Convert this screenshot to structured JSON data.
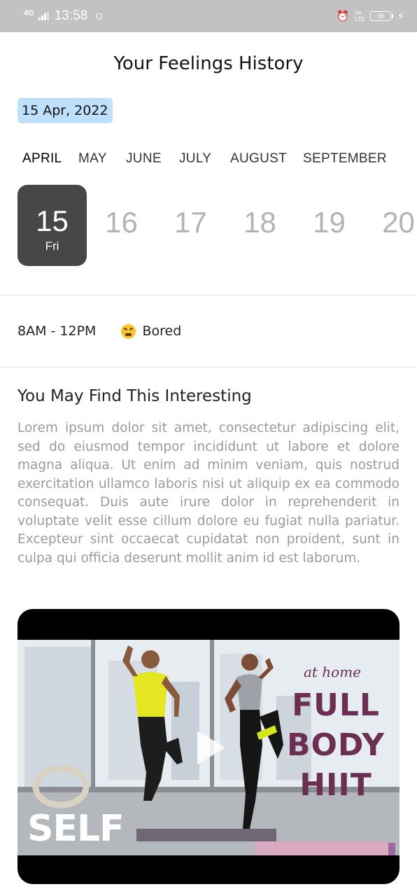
{
  "status_bar": {
    "network": "4G",
    "time": "13:58",
    "lte_label": "LTE",
    "volte_label": "Vo",
    "battery": "96",
    "icons": [
      "signal-icon",
      "usb-icon",
      "alarm-icon",
      "volte-icon",
      "battery-icon",
      "charging-icon"
    ]
  },
  "header": {
    "title": "Your Feelings History"
  },
  "selected_date": "15 Apr, 2022",
  "months": [
    {
      "label": "APRIL",
      "active": true
    },
    {
      "label": "MAY",
      "active": false
    },
    {
      "label": "JUNE",
      "active": false
    },
    {
      "label": "JULY",
      "active": false
    },
    {
      "label": "AUGUST",
      "active": false
    },
    {
      "label": "SEPTEMBER",
      "active": false
    }
  ],
  "days": [
    {
      "num": "15",
      "name": "Fri",
      "active": true
    },
    {
      "num": "16",
      "name": "",
      "active": false
    },
    {
      "num": "17",
      "name": "",
      "active": false
    },
    {
      "num": "18",
      "name": "",
      "active": false
    },
    {
      "num": "19",
      "name": "",
      "active": false
    },
    {
      "num": "20",
      "name": "",
      "active": false
    }
  ],
  "feeling": {
    "time_range": "8AM - 12PM",
    "emoji_icon": "tired-face-emoji-icon",
    "label": "Bored"
  },
  "suggestion": {
    "title": "You May Find This Interesting",
    "body": "Lorem ipsum dolor sit amet, consectetur adipiscing elit, sed do eiusmod tempor incididunt ut labore et dolore magna aliqua. Ut enim ad minim veniam, quis nostrud exercitation ullamco laboris nisi ut aliquip ex ea commodo consequat. Duis aute irure dolor in reprehenderit in voluptate velit esse cillum dolore eu fugiat nulla pariatur. Excepteur sint occaecat cupidatat non proident, sunt in culpa qui officia deserunt mollit anim id est laborum."
  },
  "video": {
    "subtitle": "at home",
    "title_lines": [
      "FULL",
      "BODY",
      "HIIT"
    ],
    "brand": "SELF",
    "play_icon": "play-icon"
  },
  "colors": {
    "status_bar_bg": "#c2c2c2",
    "date_chip_bg": "#bee0fb",
    "active_day_bg": "#474747",
    "video_title": "#6b2f53"
  }
}
